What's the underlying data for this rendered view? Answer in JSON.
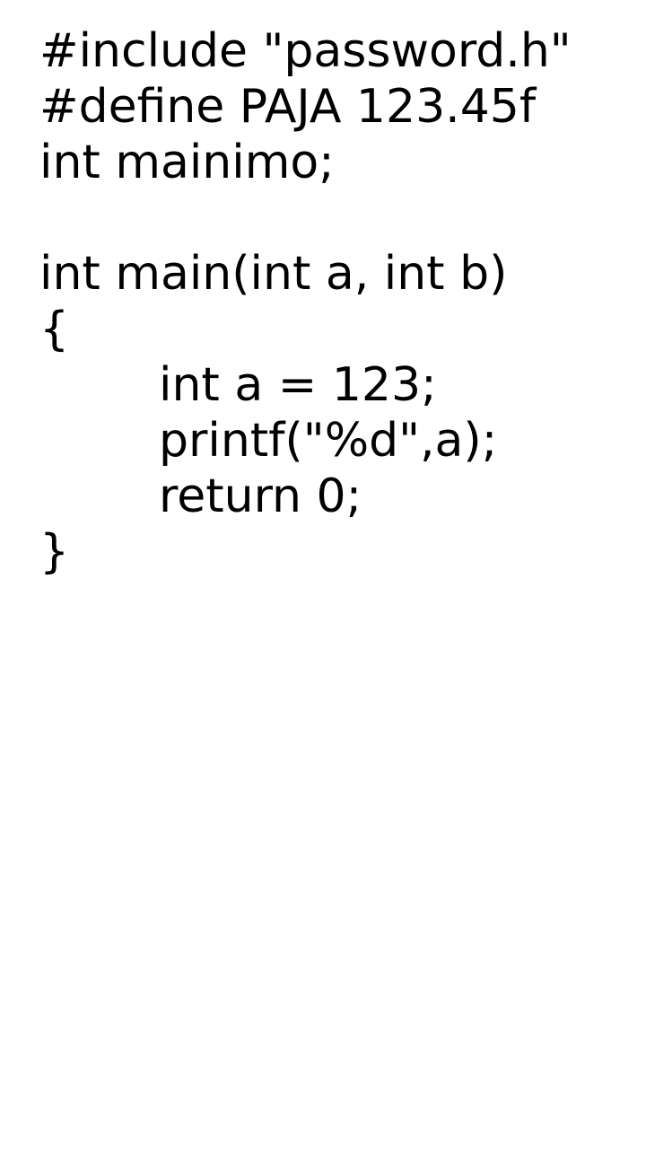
{
  "code": {
    "lines": [
      "#include \"password.h\"",
      "#define PAJA 123.45f",
      "int mainimo;",
      "",
      "int main(int a, int b)",
      "{",
      "int a = 123;",
      "printf(\"%d\",a);",
      "return 0;",
      "}"
    ]
  }
}
